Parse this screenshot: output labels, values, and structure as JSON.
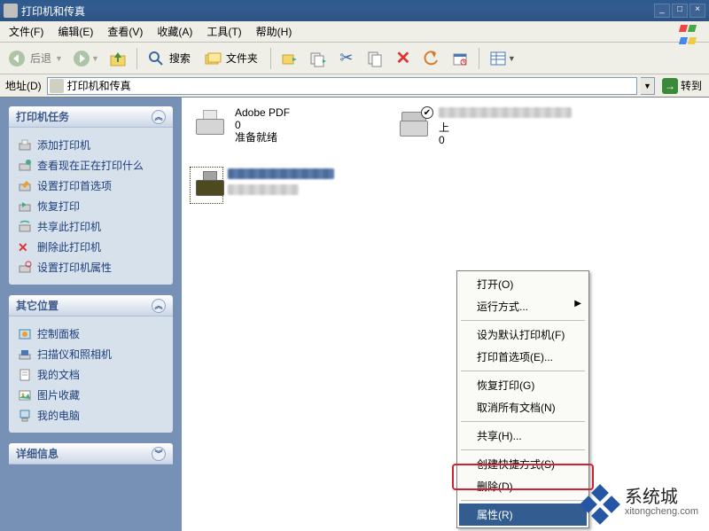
{
  "titlebar": {
    "title": "打印机和传真"
  },
  "window_buttons": {
    "min": "_",
    "max": "□",
    "close": "×"
  },
  "menubar": {
    "file": "文件(F)",
    "edit": "编辑(E)",
    "view": "查看(V)",
    "favorites": "收藏(A)",
    "tools": "工具(T)",
    "help": "帮助(H)"
  },
  "toolbar": {
    "back": "后退",
    "search": "搜索",
    "folders": "文件夹"
  },
  "addressbar": {
    "label": "地址(D)",
    "value": "打印机和传真",
    "go": "转到"
  },
  "sidebar": {
    "panels": [
      {
        "title": "打印机任务",
        "items": [
          "添加打印机",
          "查看现在正在打印什么",
          "设置打印首选项",
          "恢复打印",
          "共享此打印机",
          "删除此打印机",
          "设置打印机属性"
        ]
      },
      {
        "title": "其它位置",
        "items": [
          "控制面板",
          "扫描仪和照相机",
          "我的文档",
          "图片收藏",
          "我的电脑"
        ]
      },
      {
        "title": "详细信息",
        "items": []
      }
    ]
  },
  "content": {
    "printers": [
      {
        "name": "Adobe PDF",
        "line2": "0",
        "line3": "准备就绪",
        "selected": false,
        "default": false
      },
      {
        "name": "",
        "line2": "上",
        "line3": "0",
        "selected": false,
        "default": true,
        "blurred": true
      },
      {
        "name": "",
        "line2": "",
        "line3": "",
        "selected": true,
        "default": false,
        "blurred": true
      }
    ]
  },
  "ctxmenu": {
    "items": [
      {
        "label": "打开(O)",
        "type": "item",
        "highlighted": false
      },
      {
        "label": "运行方式...",
        "type": "item",
        "submenu": true
      },
      {
        "type": "sep"
      },
      {
        "label": "设为默认打印机(F)",
        "type": "item"
      },
      {
        "label": "打印首选项(E)...",
        "type": "item"
      },
      {
        "type": "sep"
      },
      {
        "label": "恢复打印(G)",
        "type": "item"
      },
      {
        "label": "取消所有文档(N)",
        "type": "item"
      },
      {
        "type": "sep"
      },
      {
        "label": "共享(H)...",
        "type": "item"
      },
      {
        "type": "sep"
      },
      {
        "label": "创建快捷方式(S)",
        "type": "item"
      },
      {
        "label": "删除(D)",
        "type": "item"
      },
      {
        "type": "sep"
      },
      {
        "label": "属性(R)",
        "type": "item",
        "highlighted": true
      }
    ]
  },
  "watermark": {
    "brand": "系统城",
    "url": "xitongcheng.com"
  }
}
